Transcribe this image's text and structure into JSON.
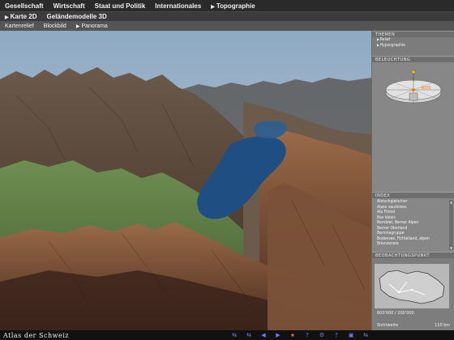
{
  "nav": {
    "top": [
      {
        "label": "Gesellschaft",
        "active": false
      },
      {
        "label": "Wirtschaft",
        "active": false
      },
      {
        "label": "Staat und Politik",
        "active": false
      },
      {
        "label": "Internationales",
        "active": false
      },
      {
        "label": "Topographie",
        "active": true
      }
    ],
    "sub": [
      {
        "label": "Karte 2D",
        "active": true
      },
      {
        "label": "Geländemodelle 3D",
        "active": false
      }
    ],
    "view": [
      {
        "label": "Kartenrelief",
        "active": false
      },
      {
        "label": "Blockbild",
        "active": false
      },
      {
        "label": "Panorama",
        "active": true
      }
    ]
  },
  "panel": {
    "themes": {
      "title": "THEMEN",
      "items": [
        {
          "label": "Relief",
          "active": true
        },
        {
          "label": "Hypsographie",
          "active": true
        }
      ]
    },
    "lighting": {
      "title": "BELEUCHTUNG",
      "height_value": "4000"
    },
    "index": {
      "title": "INDEX",
      "items": [
        "Aletschgletscher",
        "Alpes vaudoises",
        "Alp Flimel",
        "Bas Valais",
        "Bernbiet, Berner Alpen",
        "Berner Oberland",
        "Berninagruppe",
        "Bodensee, Fichtelland, alpen",
        "Brienzersee"
      ]
    },
    "observation": {
      "title": "BEOBACHTUNGSPUNKT",
      "coords": "600'000 / 200'000",
      "visibility_label": "Sichtweite",
      "visibility_value": "110 km"
    }
  },
  "footer": {
    "brand": "Atlas der Schweiz",
    "controls": [
      "⇆",
      "⇆",
      "◀",
      "▶",
      "⏹",
      "?",
      "⚙",
      "?",
      "▣",
      "⇆"
    ]
  },
  "colors": {
    "water": "#1f4f82",
    "sky": "#9ab2c8",
    "panel": "#8a8a8a"
  }
}
